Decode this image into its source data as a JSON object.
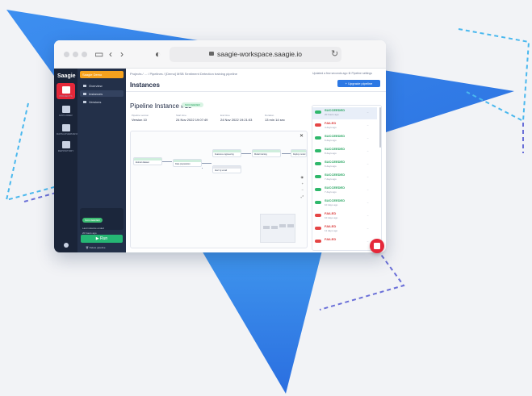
{
  "browser": {
    "url": "saagie-workspace.saagie.io"
  },
  "rail": {
    "logo": "Saagie",
    "items": [
      {
        "label": "PROJECTS",
        "icon": "folder-icon"
      },
      {
        "label": "EXPLORER",
        "icon": "grid-icon"
      },
      {
        "label": "DATAGOVERNANCE",
        "icon": "shield-icon"
      },
      {
        "label": "REPOSITORY",
        "icon": "store-icon"
      }
    ]
  },
  "nav": {
    "project_name": "Saagie Demo",
    "items": [
      {
        "label": "Overview",
        "icon": "overview-icon"
      },
      {
        "label": "Instances",
        "icon": "instances-icon"
      },
      {
        "label": "Versions",
        "icon": "versions-icon"
      }
    ],
    "status": {
      "badge": "SUCCEEDED",
      "line1": "Last instance ended",
      "line2": "20 hours ago"
    },
    "run_label": "Run",
    "delete_label": "Delete pipeline"
  },
  "header": {
    "breadcrumb": "Projects  /  ...  /  Pipelines  /  [Demo] MSB Sentiment Detection training pipeline",
    "updated": "Updated a few seconds ago",
    "settings": "Pipeline settings",
    "title": "Instances",
    "upgrade_label": "Upgrade pipeline"
  },
  "instance": {
    "title": "Pipeline Instance #13",
    "status": "SUCCEEDED",
    "meta": [
      {
        "label": "Pipeline version",
        "value": "Version 10"
      },
      {
        "label": "Start time",
        "value": "24 Nov 2022 19:07:49"
      },
      {
        "label": "End time",
        "value": "24 Nov 2022 19:21:03"
      },
      {
        "label": "Duration",
        "value": "13 min 14 sec"
      }
    ]
  },
  "graph": {
    "nodes": [
      {
        "status": "SUCCEEDED",
        "label": "Extract dataset"
      },
      {
        "status": "SUCCEEDED",
        "label": "Data preparation"
      },
      {
        "status": "SUCCEEDED",
        "label": "Features engineering"
      },
      {
        "status": "SUCCEEDED",
        "label": "Model training"
      },
      {
        "status": "SUCCEEDED",
        "label": "Deploy model"
      },
      {
        "status": "SKIPPED",
        "label": "Alert by email"
      }
    ]
  },
  "runs": [
    {
      "status": "SUCCEEDED",
      "time": "20 hours ago",
      "ok": true
    },
    {
      "status": "FAILED",
      "time": "4 days ago",
      "ok": false
    },
    {
      "status": "SUCCEEDED",
      "time": "6 days ago",
      "ok": true
    },
    {
      "status": "SUCCEEDED",
      "time": "8 days ago",
      "ok": true
    },
    {
      "status": "SUCCEEDED",
      "time": "6 days ago",
      "ok": true
    },
    {
      "status": "SUCCEEDED",
      "time": "7 days ago",
      "ok": true
    },
    {
      "status": "SUCCEEDED",
      "time": "7 days ago",
      "ok": true
    },
    {
      "status": "SUCCEEDED",
      "time": "10 days ago",
      "ok": true
    },
    {
      "status": "FAILED",
      "time": "10 days ago",
      "ok": false
    },
    {
      "status": "FAILED",
      "time": "11 days ago",
      "ok": false
    },
    {
      "status": "FAILED",
      "time": "",
      "ok": false
    }
  ],
  "colors": {
    "brand_red": "#e5283a",
    "success": "#2fb86b",
    "failed": "#e54545",
    "upgrade_blue": "#2c78e4",
    "triangle_blue": "#2c85e8"
  }
}
